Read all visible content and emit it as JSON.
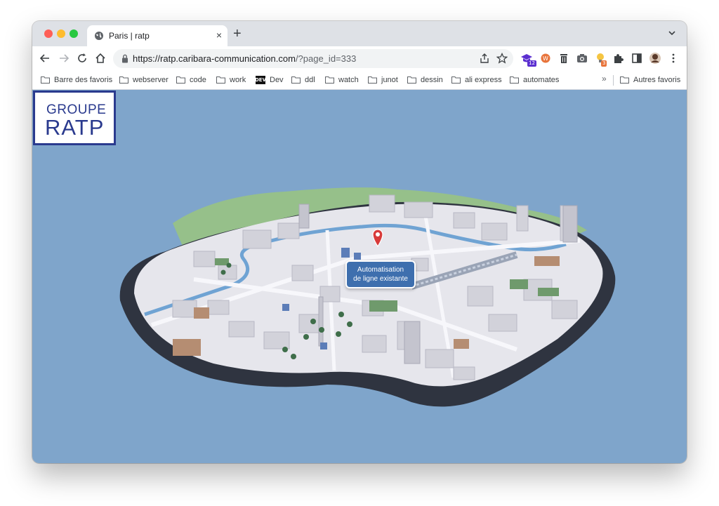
{
  "browser": {
    "tab": {
      "title": "Paris | ratp",
      "close": "×"
    },
    "new_tab": "+",
    "url": {
      "host": "https://ratp.caribara-communication.com",
      "path": "/?page_id=333"
    },
    "extensions": [
      {
        "icon": "graduation-cap-icon",
        "badge": "12",
        "color": "#5b2fd0"
      },
      {
        "icon": "wordpress-icon",
        "color": "#e8743b"
      },
      {
        "icon": "trash-icon",
        "color": "#5f6368"
      },
      {
        "icon": "camera-icon",
        "color": "#5f6368"
      },
      {
        "icon": "lightbulb-icon",
        "badge": "3",
        "color": "#e8743b"
      },
      {
        "icon": "puzzle-icon",
        "color": "#3c4043"
      },
      {
        "icon": "sidebar-icon",
        "color": "#3c4043"
      },
      {
        "icon": "avatar-icon",
        "color": "#5a3a2a"
      }
    ]
  },
  "bookmarks": {
    "items": [
      {
        "label": "Barre des favoris",
        "icon": "folder-icon"
      },
      {
        "label": "webserver",
        "icon": "folder-icon"
      },
      {
        "label": "code",
        "icon": "folder-icon"
      },
      {
        "label": "work",
        "icon": "folder-icon"
      },
      {
        "label": "Dev",
        "icon": "dev-icon"
      },
      {
        "label": "ddl",
        "icon": "folder-icon"
      },
      {
        "label": "watch",
        "icon": "folder-icon"
      },
      {
        "label": "junot",
        "icon": "folder-icon"
      },
      {
        "label": "dessin",
        "icon": "folder-icon"
      },
      {
        "label": "ali express",
        "icon": "folder-icon"
      },
      {
        "label": "automates",
        "icon": "folder-icon"
      }
    ],
    "overflow": "»",
    "other": "Autres favoris"
  },
  "page": {
    "logo": {
      "top": "GROUPE",
      "bottom": "RATP",
      "color": "#2a3a8e"
    },
    "callout": {
      "line1": "Automatisation",
      "line2": "de ligne existante",
      "color": "#3e6fae"
    },
    "background_color": "#7fa5cb",
    "dev_icon_text": "DEV"
  }
}
